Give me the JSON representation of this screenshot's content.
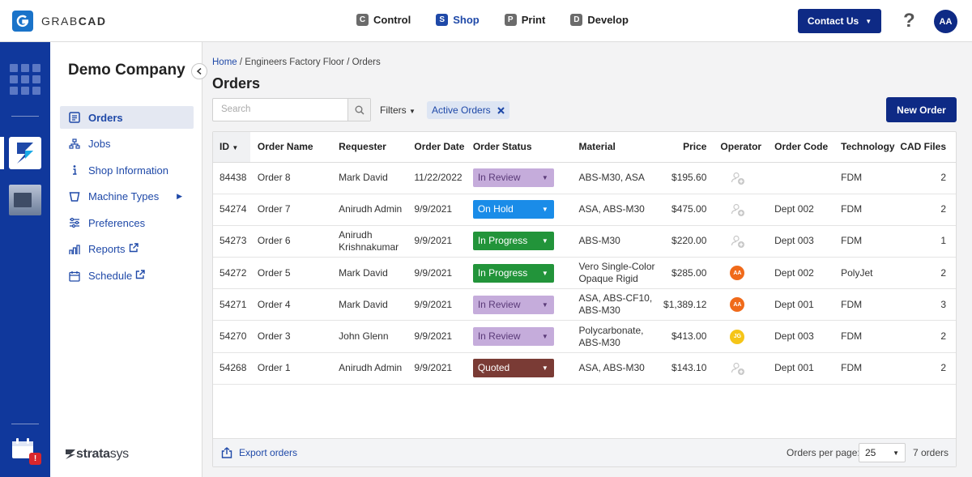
{
  "app": {
    "logo_text_a": "GRAB",
    "logo_text_b": "CAD",
    "nav": [
      {
        "badge": "C",
        "label": "Control",
        "active": false
      },
      {
        "badge": "S",
        "label": "Shop",
        "active": true
      },
      {
        "badge": "P",
        "label": "Print",
        "active": false
      },
      {
        "badge": "D",
        "label": "Develop",
        "active": false
      }
    ],
    "contact_label": "Contact Us",
    "help_label": "?",
    "user_initials": "AA"
  },
  "sidebar": {
    "company": "Demo Company",
    "items": [
      {
        "label": "Orders",
        "icon": "orders-icon",
        "active": true
      },
      {
        "label": "Jobs",
        "icon": "jobs-icon"
      },
      {
        "label": "Shop Information",
        "icon": "info-icon"
      },
      {
        "label": "Machine Types",
        "icon": "machine-icon",
        "caret": true
      },
      {
        "label": "Preferences",
        "icon": "sliders-icon"
      },
      {
        "label": "Reports",
        "icon": "reports-icon",
        "external": true
      },
      {
        "label": "Schedule",
        "icon": "calendar-icon",
        "external": true
      }
    ],
    "brand_a": "strata",
    "brand_b": "sys"
  },
  "rail": {
    "alert_label": "!"
  },
  "main": {
    "breadcrumb": {
      "home": "Home",
      "sep1": " / ",
      "level2": "Engineers Factory Floor",
      "sep2": " / ",
      "current": "Orders"
    },
    "title": "Orders",
    "search_placeholder": "Search",
    "filters_label": "Filters",
    "active_chip": "Active Orders",
    "new_order_label": "New Order"
  },
  "table": {
    "headers": [
      "ID",
      "Order Name",
      "Requester",
      "Order Date",
      "Order Status",
      "Material",
      "Price",
      "Operator",
      "Order Code",
      "Technology",
      "CAD Files"
    ],
    "rows": [
      {
        "id": "84438",
        "name": "Order 8",
        "requester": "Mark David",
        "date": "11/22/2022",
        "status": "In Review",
        "status_color": "#c5acdb",
        "status_text": "#5a3a78",
        "material": "ABS-M30, ASA",
        "price": "$195.60",
        "operator": "",
        "operator_color": "",
        "code": "",
        "tech": "FDM",
        "files": "2"
      },
      {
        "id": "54274",
        "name": "Order 7",
        "requester": "Anirudh Admin",
        "date": "9/9/2021",
        "status": "On Hold",
        "status_color": "#1a8ce8",
        "status_text": "#ffffff",
        "material": "ASA, ABS-M30",
        "price": "$475.00",
        "operator": "",
        "operator_color": "",
        "code": "Dept 002",
        "tech": "FDM",
        "files": "2"
      },
      {
        "id": "54273",
        "name": "Order 6",
        "requester": "Anirudh Krishnakumar",
        "date": "9/9/2021",
        "status": "In Progress",
        "status_color": "#22943a",
        "status_text": "#ffffff",
        "material": "ABS-M30",
        "price": "$220.00",
        "operator": "",
        "operator_color": "",
        "code": "Dept 003",
        "tech": "FDM",
        "files": "1"
      },
      {
        "id": "54272",
        "name": "Order 5",
        "requester": "Mark David",
        "date": "9/9/2021",
        "status": "In Progress",
        "status_color": "#22943a",
        "status_text": "#ffffff",
        "material": "Vero Single-Color Opaque Rigid",
        "price": "$285.00",
        "operator": "AA",
        "operator_color": "#f06a1a",
        "code": "Dept 002",
        "tech": "PolyJet",
        "files": "2"
      },
      {
        "id": "54271",
        "name": "Order 4",
        "requester": "Mark David",
        "date": "9/9/2021",
        "status": "In Review",
        "status_color": "#c5acdb",
        "status_text": "#5a3a78",
        "material": "ASA, ABS-CF10, ABS-M30",
        "price": "$1,389.12",
        "operator": "AA",
        "operator_color": "#f06a1a",
        "code": "Dept 001",
        "tech": "FDM",
        "files": "3"
      },
      {
        "id": "54270",
        "name": "Order 3",
        "requester": "John Glenn",
        "date": "9/9/2021",
        "status": "In Review",
        "status_color": "#c5acdb",
        "status_text": "#5a3a78",
        "material": "Polycarbonate, ABS-M30",
        "price": "$413.00",
        "operator": "JG",
        "operator_color": "#f5c518",
        "code": "Dept 003",
        "tech": "FDM",
        "files": "2"
      },
      {
        "id": "54268",
        "name": "Order 1",
        "requester": "Anirudh Admin",
        "date": "9/9/2021",
        "status": "Quoted",
        "status_color": "#7a3b35",
        "status_text": "#ffffff",
        "material": "ASA, ABS-M30",
        "price": "$143.10",
        "operator": "",
        "operator_color": "",
        "code": "Dept 001",
        "tech": "FDM",
        "files": "2"
      }
    ]
  },
  "footer": {
    "export_label": "Export orders",
    "per_page_label": "Orders per page:",
    "per_page_value": "25",
    "count_label": "7 orders"
  }
}
